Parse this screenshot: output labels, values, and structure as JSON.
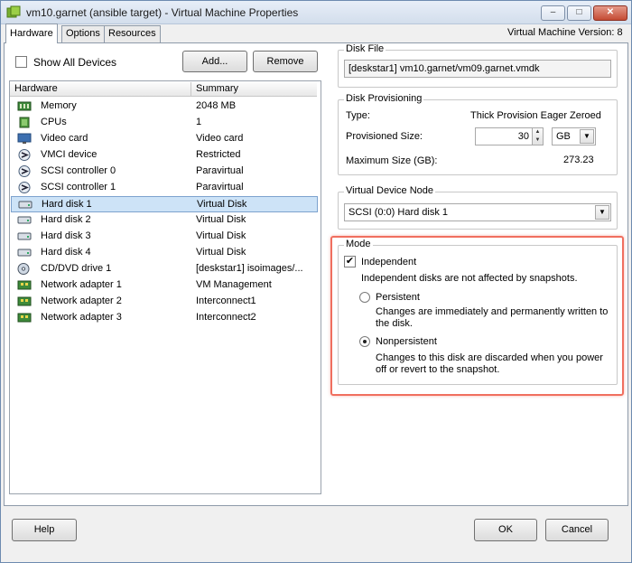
{
  "window": {
    "title": "vm10.garnet (ansible target) - Virtual Machine Properties",
    "controls": {
      "minimize": "–",
      "maximize": "□",
      "close": "✕"
    }
  },
  "tabs": [
    "Hardware",
    "Options",
    "Resources"
  ],
  "version_label": "Virtual Machine Version: 8",
  "hardware": {
    "show_all_label": "Show All Devices",
    "show_all_checked": false,
    "add_button": "Add...",
    "remove_button": "Remove",
    "columns": [
      "Hardware",
      "Summary"
    ],
    "rows": [
      {
        "name": "Memory",
        "summary": "2048 MB",
        "icon": "memory-icon"
      },
      {
        "name": "CPUs",
        "summary": "1",
        "icon": "cpu-icon"
      },
      {
        "name": "Video card",
        "summary": "Video card",
        "icon": "monitor-icon"
      },
      {
        "name": "VMCI device",
        "summary": "Restricted",
        "icon": "vmci-icon"
      },
      {
        "name": "SCSI controller 0",
        "summary": "Paravirtual",
        "icon": "scsi-controller-icon"
      },
      {
        "name": "SCSI controller 1",
        "summary": "Paravirtual",
        "icon": "scsi-controller-icon"
      },
      {
        "name": "Hard disk 1",
        "summary": "Virtual Disk",
        "icon": "hard-disk-icon",
        "selected": true
      },
      {
        "name": "Hard disk 2",
        "summary": "Virtual Disk",
        "icon": "hard-disk-icon"
      },
      {
        "name": "Hard disk 3",
        "summary": "Virtual Disk",
        "icon": "hard-disk-icon"
      },
      {
        "name": "Hard disk 4",
        "summary": "Virtual Disk",
        "icon": "hard-disk-icon"
      },
      {
        "name": "CD/DVD drive 1",
        "summary": "[deskstar1] isoimages/...",
        "icon": "cd-drive-icon"
      },
      {
        "name": "Network adapter 1",
        "summary": "VM Management",
        "icon": "network-adapter-icon"
      },
      {
        "name": "Network adapter 2",
        "summary": "Interconnect1",
        "icon": "network-adapter-icon"
      },
      {
        "name": "Network adapter 3",
        "summary": "Interconnect2",
        "icon": "network-adapter-icon"
      }
    ]
  },
  "disk_file": {
    "title": "Disk File",
    "value": "[deskstar1] vm10.garnet/vm09.garnet.vmdk"
  },
  "disk_provisioning": {
    "title": "Disk Provisioning",
    "type_label": "Type:",
    "type_value": "Thick Provision Eager Zeroed",
    "size_label": "Provisioned Size:",
    "size_value": "30",
    "size_unit": "GB",
    "max_label": "Maximum Size (GB):",
    "max_value": "273.23"
  },
  "virtual_device_node": {
    "title": "Virtual Device Node",
    "selected": "SCSI (0:0) Hard disk 1"
  },
  "mode": {
    "title": "Mode",
    "independent_label": "Independent",
    "independent_checked": true,
    "independent_desc": "Independent disks are not affected by snapshots.",
    "persistent_label": "Persistent",
    "persistent_desc_1": "Changes are immediately and permanently written to",
    "persistent_desc_2": "the disk.",
    "nonpersistent_label": "Nonpersistent",
    "nonpersistent_desc_1": "Changes to this disk are discarded when you power",
    "nonpersistent_desc_2": "off or revert to the snapshot.",
    "selected": "Nonpersistent"
  },
  "footer": {
    "help": "Help",
    "ok": "OK",
    "cancel": "Cancel"
  },
  "colors": {
    "highlight": "#f06f5f",
    "selection": "#cde3f7",
    "border": "#8e9aa9"
  }
}
